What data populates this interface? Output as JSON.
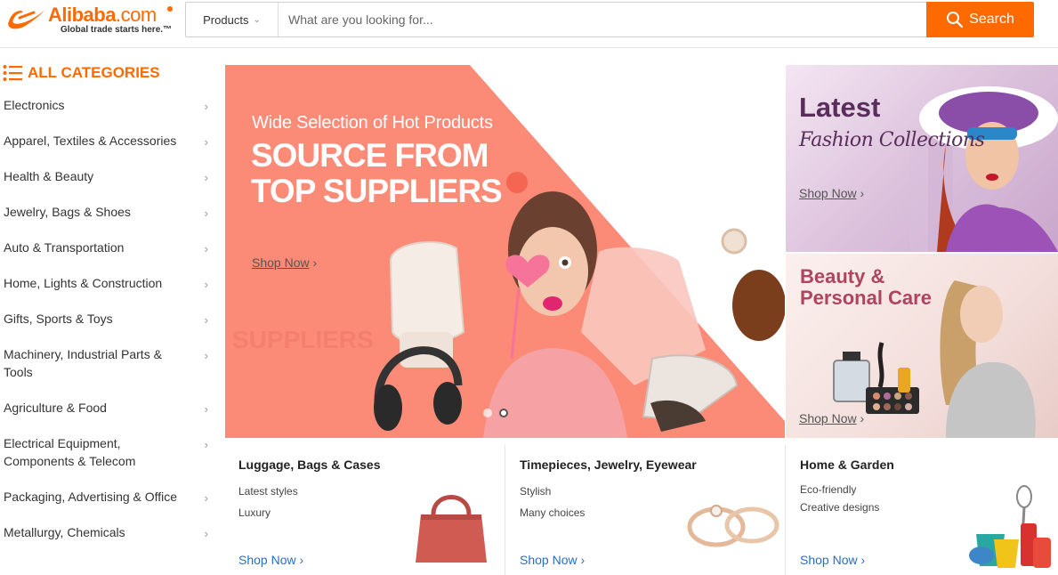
{
  "header": {
    "logo_brand": "Alibaba",
    "logo_domain": ".com",
    "logo_tagline": "Global trade starts here.™",
    "search_category": "Products",
    "search_placeholder": "What are you looking for...",
    "search_button": "Search"
  },
  "sidebar": {
    "title": "ALL CATEGORIES",
    "items": [
      {
        "label": "Electronics"
      },
      {
        "label": "Apparel, Textiles & Accessories"
      },
      {
        "label": "Health & Beauty"
      },
      {
        "label": "Jewelry, Bags & Shoes"
      },
      {
        "label": "Auto & Transportation"
      },
      {
        "label": "Home, Lights & Construction"
      },
      {
        "label": "Gifts, Sports & Toys"
      },
      {
        "label": "Machinery, Industrial Parts & Tools"
      },
      {
        "label": "Agriculture & Food"
      },
      {
        "label": "Electrical Equipment, Components & Telecom"
      },
      {
        "label": "Packaging, Advertising & Office"
      },
      {
        "label": "Metallurgy, Chemicals"
      }
    ]
  },
  "banner": {
    "subtitle": "Wide Selection of Hot Products",
    "title": "SOURCE FROM TOP SUPPLIERS",
    "shop_label": "Shop Now",
    "arrow": "›"
  },
  "promos": {
    "fashion": {
      "title": "Latest",
      "subtitle": "Fashion Collections",
      "shop_label": "Shop Now",
      "arrow": "›"
    },
    "beauty": {
      "title": "Beauty & Personal Care",
      "shop_label": "Shop Now",
      "arrow": "›"
    }
  },
  "cards": [
    {
      "title": "Luggage, Bags & Cases",
      "line1": "Latest styles",
      "line2": "Luxury",
      "shop_label": "Shop Now  ›"
    },
    {
      "title": "Timepieces, Jewelry, Eyewear",
      "line1": "Stylish",
      "line2": "Many choices",
      "shop_label": "Shop Now  ›"
    },
    {
      "title": "Home & Garden",
      "line1": "Eco-friendly",
      "line2": "Creative designs",
      "shop_label": "Shop Now  ›"
    }
  ],
  "icons": {
    "chevron": "›",
    "dropdown": "⌄"
  },
  "colors": {
    "brand_orange": "#ff6a00",
    "banner_coral": "#fb8a76",
    "link_blue": "#2a6dc2"
  }
}
